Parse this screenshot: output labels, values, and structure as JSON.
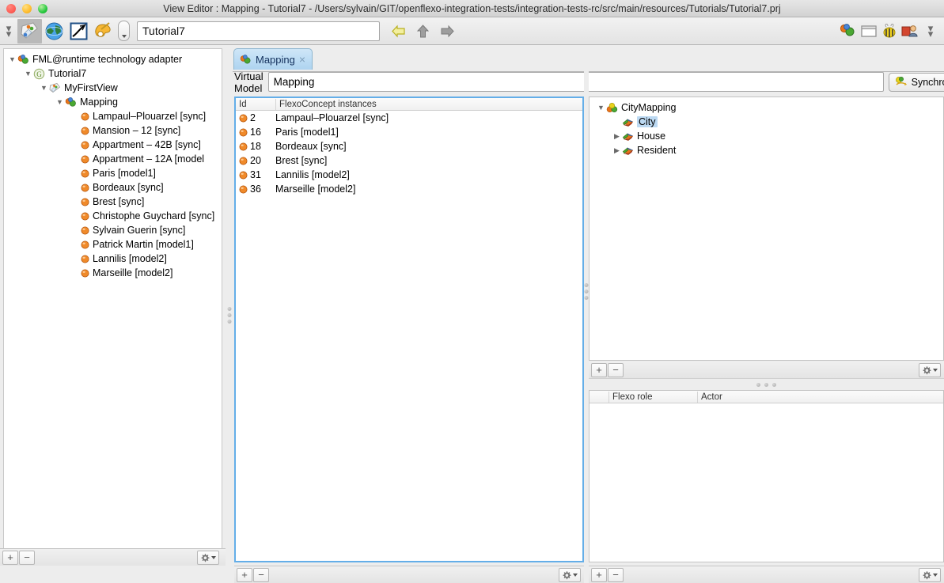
{
  "window": {
    "title": "View Editor : Mapping - Tutorial7 - /Users/sylvain/GIT/openflexo-integration-tests/integration-tests-rc/src/main/resources/Tutorials/Tutorial7.prj"
  },
  "toolbar": {
    "path_value": "Tutorial7",
    "icons": [
      "view-editor-icon",
      "globe-icon",
      "diagram-icon",
      "palette-icon"
    ],
    "nav": [
      "back-arrow-icon",
      "up-arrow-icon",
      "forward-arrow-icon"
    ],
    "right_icons": [
      "mapping-perspective-icon",
      "window-perspective-icon",
      "bee-perspective-icon",
      "user-perspective-icon",
      "chevrons-down-icon"
    ]
  },
  "left_tree": [
    {
      "indent": 0,
      "twist": "▼",
      "icon": "fml-runtime-icon",
      "label": "FML@runtime technology adapter"
    },
    {
      "indent": 1,
      "twist": "▼",
      "icon": "project-icon",
      "label": "Tutorial7"
    },
    {
      "indent": 2,
      "twist": "▼",
      "icon": "view-icon",
      "label": "MyFirstView"
    },
    {
      "indent": 3,
      "twist": "▼",
      "icon": "mapping-icon",
      "label": "Mapping"
    },
    {
      "indent": 4,
      "twist": "",
      "icon": "instance-icon",
      "label": "Lampaul–Plouarzel [sync]"
    },
    {
      "indent": 4,
      "twist": "",
      "icon": "instance-icon",
      "label": "Mansion – 12 [sync]"
    },
    {
      "indent": 4,
      "twist": "",
      "icon": "instance-icon",
      "label": "Appartment –  42B [sync]"
    },
    {
      "indent": 4,
      "twist": "",
      "icon": "instance-icon",
      "label": "Appartment –  12A [model"
    },
    {
      "indent": 4,
      "twist": "",
      "icon": "instance-icon",
      "label": "Paris [model1]"
    },
    {
      "indent": 4,
      "twist": "",
      "icon": "instance-icon",
      "label": "Bordeaux [sync]"
    },
    {
      "indent": 4,
      "twist": "",
      "icon": "instance-icon",
      "label": "Brest [sync]"
    },
    {
      "indent": 4,
      "twist": "",
      "icon": "instance-icon",
      "label": "Christophe Guychard [sync]"
    },
    {
      "indent": 4,
      "twist": "",
      "icon": "instance-icon",
      "label": "Sylvain Guerin [sync]"
    },
    {
      "indent": 4,
      "twist": "",
      "icon": "instance-icon",
      "label": "Patrick Martin [model1]"
    },
    {
      "indent": 4,
      "twist": "",
      "icon": "instance-icon",
      "label": "Lannilis [model2]"
    },
    {
      "indent": 4,
      "twist": "",
      "icon": "instance-icon",
      "label": "Marseille [model2]"
    }
  ],
  "tab": {
    "label": "Mapping",
    "close": "×"
  },
  "virtual_model": {
    "label": "Virtual Model",
    "value": "Mapping"
  },
  "sync_button": {
    "label": "Synchronize..."
  },
  "center_table": {
    "columns": [
      "Id",
      "FlexoConcept instances"
    ],
    "rows": [
      {
        "id": "2",
        "name": "Lampaul–Plouarzel [sync]"
      },
      {
        "id": "16",
        "name": "Paris [model1]"
      },
      {
        "id": "18",
        "name": "Bordeaux [sync]"
      },
      {
        "id": "20",
        "name": "Brest [sync]"
      },
      {
        "id": "31",
        "name": "Lannilis [model2]"
      },
      {
        "id": "36",
        "name": "Marseille [model2]"
      }
    ]
  },
  "right_tree": [
    {
      "indent": 0,
      "twist": "▼",
      "icon": "virtual-model-icon",
      "label": "CityMapping",
      "selected": false
    },
    {
      "indent": 1,
      "twist": "",
      "icon": "flexo-concept-icon",
      "label": "City",
      "selected": true
    },
    {
      "indent": 1,
      "twist": "▶",
      "icon": "flexo-concept-icon",
      "label": "House",
      "selected": false
    },
    {
      "indent": 1,
      "twist": "▶",
      "icon": "flexo-concept-icon",
      "label": "Resident",
      "selected": false
    }
  ],
  "right_table": {
    "columns": [
      "Flexo role",
      "Actor"
    ],
    "rows": []
  },
  "footers": {
    "add_label": "+",
    "remove_label": "−",
    "gear_label": "gear-icon"
  },
  "colors": {
    "accent_border": "#64aee8",
    "tab_bg": "#bcdcf4",
    "selection": "#bcd9f2",
    "chrome": "#ededed"
  }
}
